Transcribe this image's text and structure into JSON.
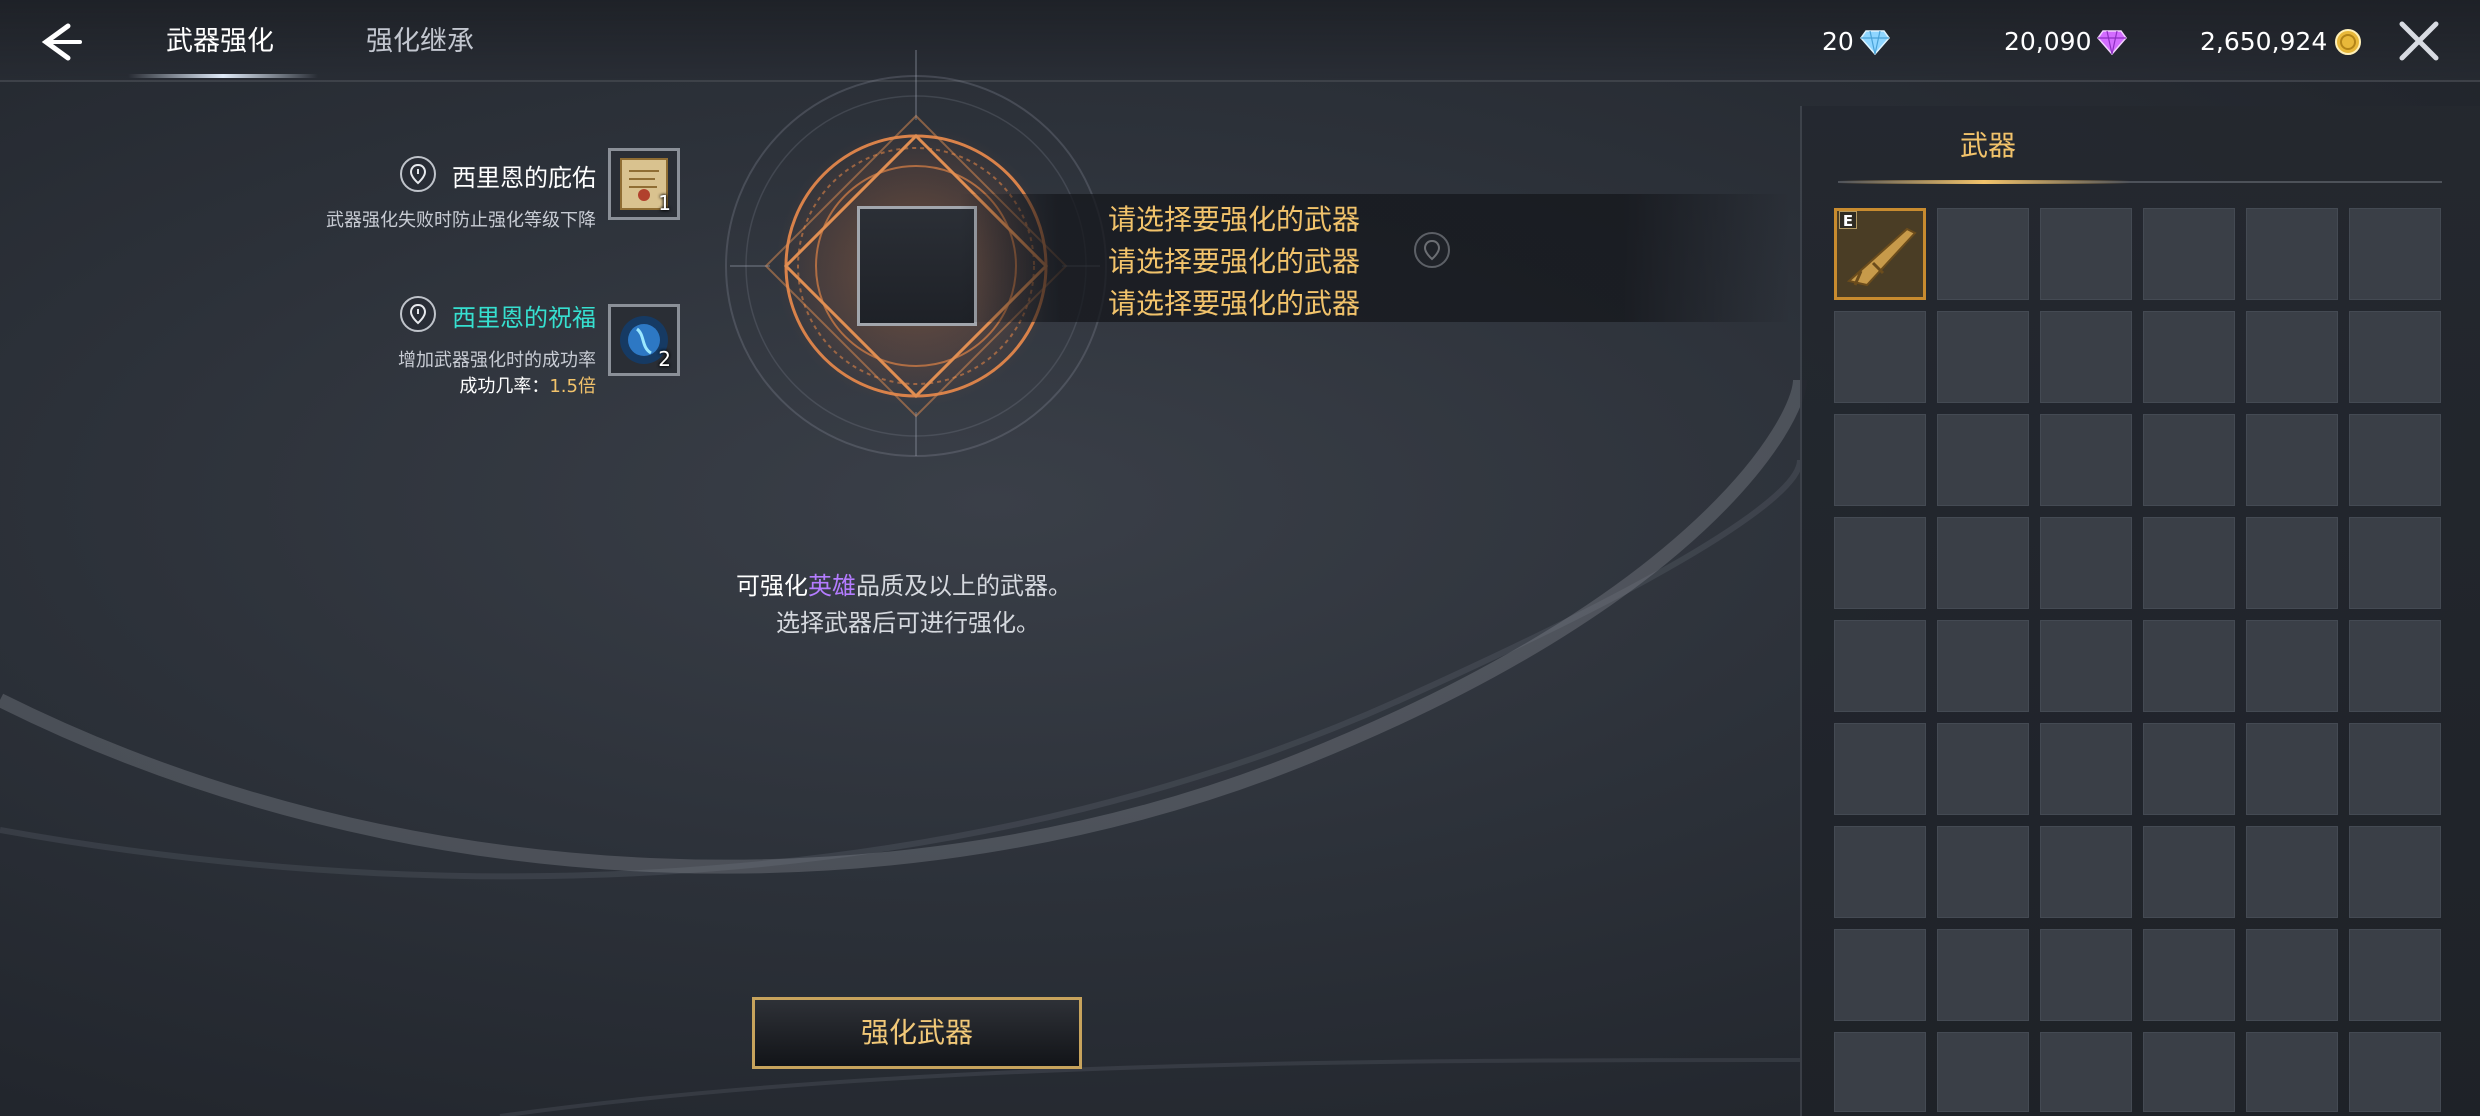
{
  "header": {
    "tabs": [
      {
        "label": "武器强化",
        "active": true
      },
      {
        "label": "强化继承",
        "active": false
      }
    ],
    "currencies": [
      {
        "value": "20",
        "icon": "blue-diamond-icon",
        "color": "#8fd6ff"
      },
      {
        "value": "20,090",
        "icon": "purple-diamond-icon",
        "color": "#d36cff"
      },
      {
        "value": "2,650,924",
        "icon": "gold-coin-icon",
        "color": "#e8b83a"
      }
    ]
  },
  "scrolls": [
    {
      "title": "西里恩的庇佑",
      "desc": "武器强化失败时防止强化等级下降",
      "count": "1",
      "title_color": "#ffffff"
    },
    {
      "title": "西里恩的祝福",
      "desc": "增加武器强化时的成功率",
      "rate_label": "成功几率：",
      "rate_value": "1.5倍",
      "count": "2",
      "title_color": "#36e0d0"
    }
  ],
  "prompt": {
    "lines": [
      "请选择要强化的武器",
      "请选择要强化的武器",
      "请选择要强化的武器"
    ]
  },
  "description": {
    "line1_prefix": "可强化",
    "line1_hero": "英雄",
    "line1_suffix": "品质及以上的武器。",
    "line2": "选择武器后可进行强化。"
  },
  "enhance_button": {
    "label": "强化武器"
  },
  "inventory": {
    "tab_label": "武器",
    "item_badge": "E",
    "columns": 6,
    "rows": 9
  },
  "colors": {
    "accent_gold": "#f2c36b",
    "hero_purple": "#b47cff",
    "blessing_cyan": "#36e0d0"
  }
}
